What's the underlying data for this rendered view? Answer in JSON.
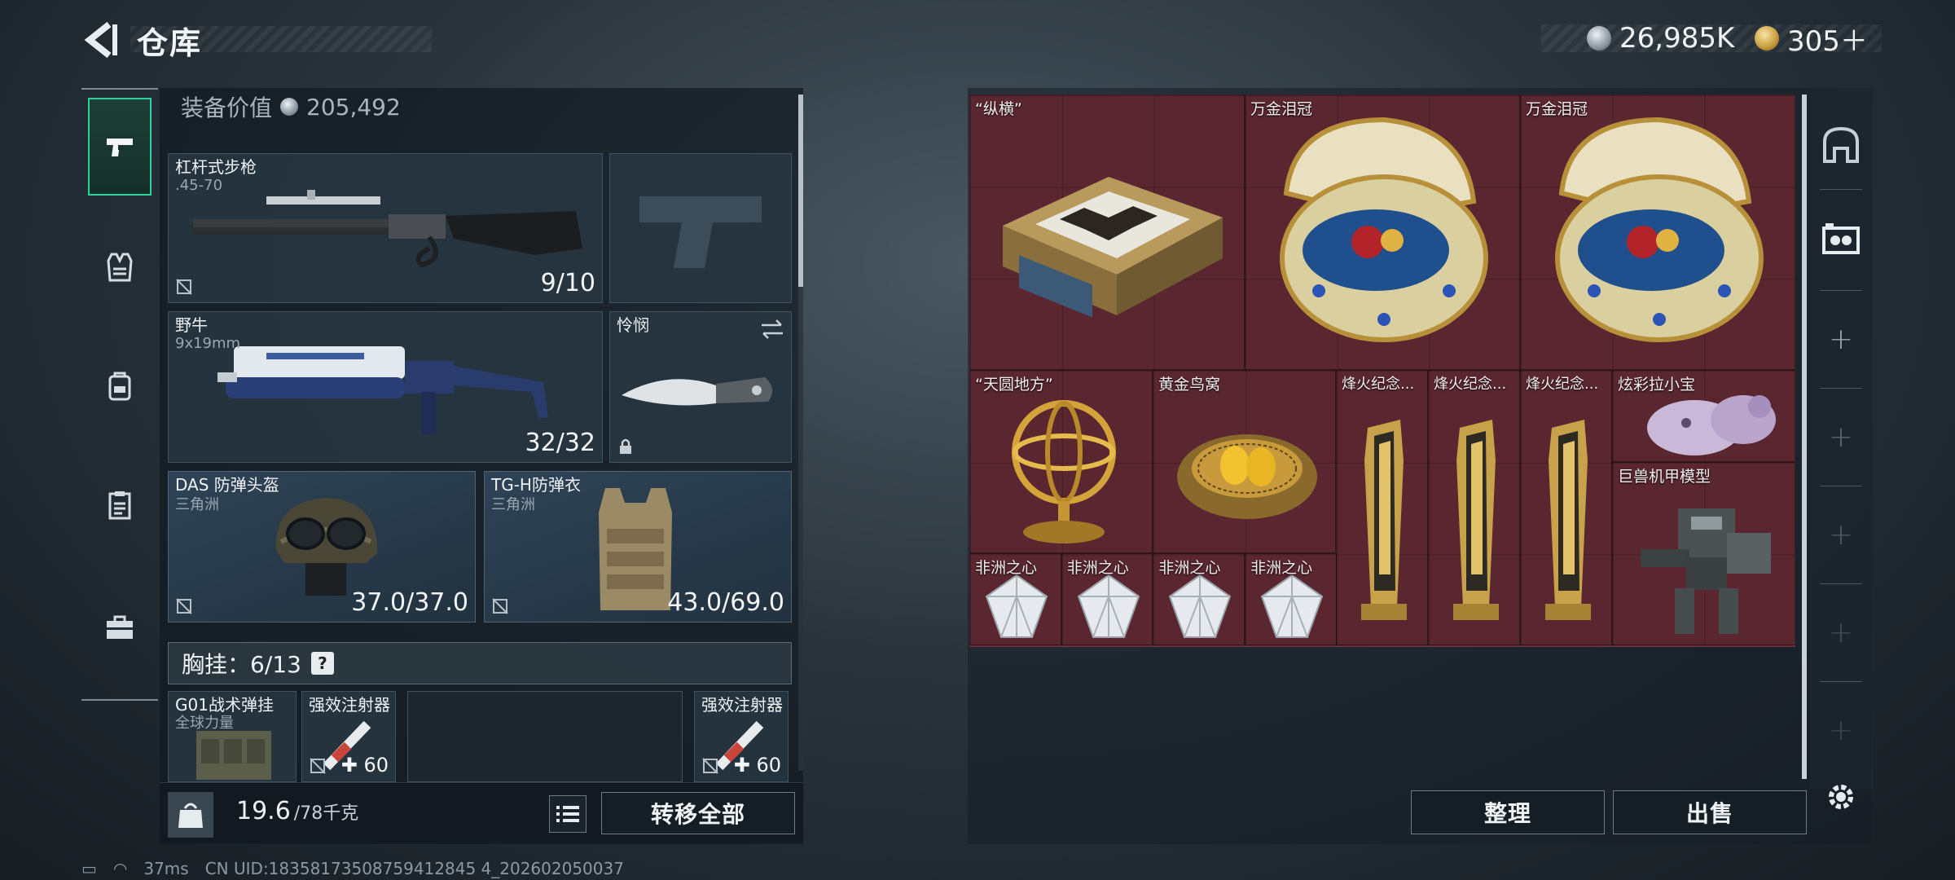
{
  "header": {
    "title": "仓库",
    "currency_silver": "26,985K",
    "currency_gold": "305＋"
  },
  "equipment": {
    "value_label": "装备价值",
    "value": "205,492",
    "primary": {
      "name": "杠杆式步枪",
      "caliber": ".45-70",
      "ammo": "9/10"
    },
    "secondary": {
      "name": "野牛",
      "caliber": "9x19mm",
      "ammo": "32/32"
    },
    "melee": {
      "name": "怜悯"
    },
    "helmet": {
      "name": "DAS 防弹头盔",
      "origin": "三角洲",
      "durability": "37.0/37.0"
    },
    "armor": {
      "name": "TG-H防弹衣",
      "origin": "三角洲",
      "durability": "43.0/69.0"
    },
    "chest_label": "胸挂：6/13",
    "chest_help": "?",
    "rig": {
      "name": "G01战术弹挂",
      "sub": "全球力量"
    },
    "injector_1": {
      "name": "强效注射器",
      "count": "60"
    },
    "injector_2": {
      "name": "强效注射器",
      "count": "60"
    }
  },
  "bottom": {
    "kg_label": "KG",
    "weight": "19.6",
    "weight_max": "/78千克",
    "transfer_all": "转移全部",
    "sort": "整理",
    "sell": "出售"
  },
  "storage": {
    "items": [
      {
        "name": "“纵横”"
      },
      {
        "name": "万金泪冠"
      },
      {
        "name": "万金泪冠"
      },
      {
        "name": "“天圆地方”"
      },
      {
        "name": "黄金鸟窝"
      },
      {
        "name": "烽火纪念..."
      },
      {
        "name": "烽火纪念..."
      },
      {
        "name": "烽火纪念..."
      },
      {
        "name": "炫彩拉小宝"
      },
      {
        "name": "巨兽机甲模型"
      },
      {
        "name": "非洲之心"
      },
      {
        "name": "非洲之心"
      },
      {
        "name": "非洲之心"
      },
      {
        "name": "非洲之心"
      }
    ]
  },
  "status": {
    "ping": "37ms",
    "uid": "CN UID:18358173508759412845 4_202602050037"
  },
  "colors": {
    "accent": "#2bd39a",
    "storage_bg": "#5a2730",
    "slot_blue": "#2e4356"
  },
  "icons": [
    "back-arrow-icon",
    "silver-coin-icon",
    "gold-coin-icon",
    "pistol-icon",
    "vest-icon",
    "backpack-icon",
    "clipboard-icon",
    "toolbox-icon",
    "no-insure-icon",
    "swap-icon",
    "lock-icon",
    "kg-weight-icon",
    "list-icon",
    "safe-icon",
    "tape-icon",
    "plus-icon",
    "gear-icon"
  ]
}
